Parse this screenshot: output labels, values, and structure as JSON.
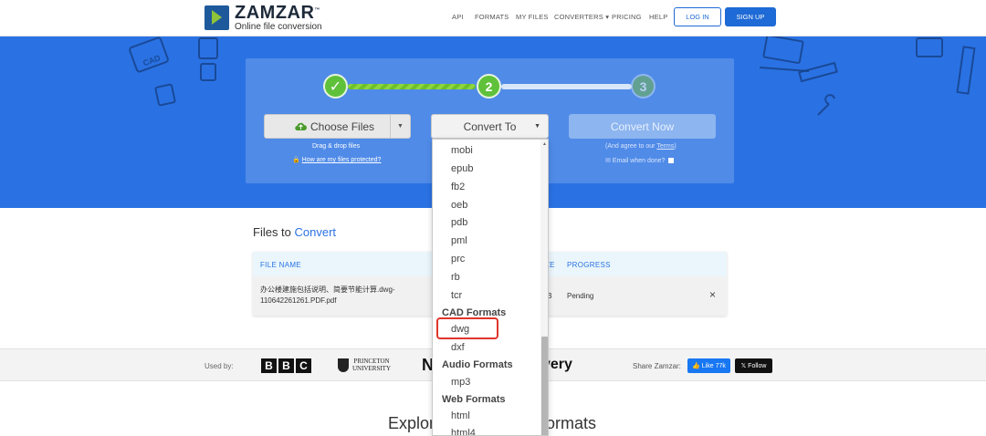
{
  "brand": {
    "name": "ZAMZAR",
    "trademark": "™",
    "tagline": "Online file conversion"
  },
  "nav": {
    "api": "API",
    "formats": "FORMATS",
    "my_files": "MY FILES",
    "converters": "CONVERTERS",
    "converters_caret": "▾",
    "pricing": "PRICING",
    "help": "HELP",
    "login": "LOG IN",
    "signup": "SIGN UP"
  },
  "steps": {
    "step1": "✓",
    "step2": "2",
    "step3": "3"
  },
  "converter": {
    "choose_files": "Choose Files",
    "drag_drop": "Drag & drop files",
    "protected_link": "How are my files protected?",
    "convert_to": "Convert To",
    "convert_now": "Convert Now",
    "agree_prefix": "(And agree to our ",
    "agree_link": "Terms",
    "agree_suffix": ")",
    "email_when_done": "Email when done?"
  },
  "files": {
    "title_prefix": "Files to ",
    "title_accent": "Convert",
    "columns": {
      "file_name": "FILE NAME",
      "size_partial": "ZE",
      "progress": "PROGRESS"
    },
    "row": {
      "name_line1": "办公楼建施包括说明、简要节能计算.dwg-",
      "name_line2": "110642261261.PDF.pdf",
      "size_partial": "IB",
      "progress": "Pending",
      "remove": "×"
    }
  },
  "dropdown": {
    "ebook_items": [
      "mobi",
      "epub",
      "fb2",
      "oeb",
      "pdb",
      "pml",
      "prc",
      "rb",
      "tcr"
    ],
    "cad_group": "CAD Formats",
    "cad_items": [
      "dwg",
      "dxf"
    ],
    "audio_group": "Audio Formats",
    "audio_items": [
      "mp3"
    ],
    "web_group": "Web Formats",
    "web_items": [
      "html",
      "html4"
    ]
  },
  "strip": {
    "used_by": "Used by:",
    "bbc": [
      "B",
      "B",
      "C"
    ],
    "princeton_line1": "PRINCETON",
    "princeton_line2": "UNIVERSITY",
    "partial_logo": "N",
    "discovery_partial": "very",
    "share": "Share Zamzar:",
    "fb_like": "👍 Like 77k",
    "x_follow": "𝕏 Follow"
  },
  "explore": {
    "left": "Explor",
    "right": "ormats"
  },
  "colors": {
    "accent": "#2a72e3",
    "step_done": "#5fc13a",
    "highlight": "#e0352b"
  }
}
